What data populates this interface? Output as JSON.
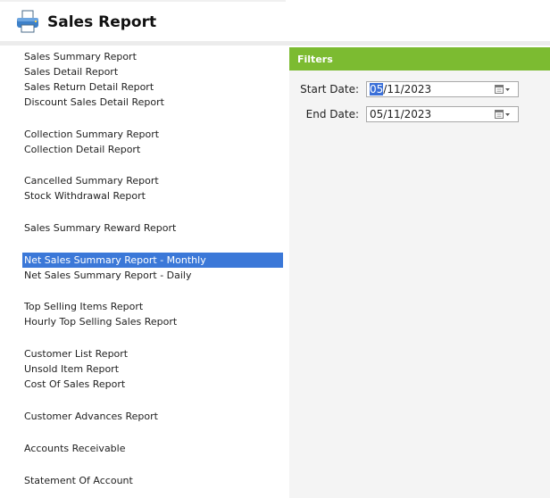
{
  "header": {
    "title": "Sales Report",
    "icon": "printer-icon"
  },
  "report_list": {
    "items": [
      {
        "label": "Sales Summary Report",
        "selected": false
      },
      {
        "label": "Sales Detail Report",
        "selected": false
      },
      {
        "label": "Sales Return Detail Report",
        "selected": false
      },
      {
        "label": "Discount Sales Detail Report",
        "selected": false
      },
      {
        "label": "Collection Summary Report",
        "selected": false
      },
      {
        "label": "Collection Detail Report",
        "selected": false
      },
      {
        "label": "Cancelled Summary Report",
        "selected": false
      },
      {
        "label": "Stock Withdrawal Report",
        "selected": false
      },
      {
        "label": "Sales Summary Reward Report",
        "selected": false
      },
      {
        "label": "Net Sales Summary Report - Monthly",
        "selected": true
      },
      {
        "label": "Net Sales Summary Report - Daily",
        "selected": false
      },
      {
        "label": "Top Selling Items Report",
        "selected": false
      },
      {
        "label": "Hourly Top Selling Sales Report",
        "selected": false
      },
      {
        "label": "Customer List Report",
        "selected": false
      },
      {
        "label": "Unsold Item Report",
        "selected": false
      },
      {
        "label": "Cost Of Sales Report",
        "selected": false
      },
      {
        "label": "Customer Advances Report",
        "selected": false
      },
      {
        "label": "Accounts Receivable",
        "selected": false
      },
      {
        "label": "Statement Of Account",
        "selected": false
      }
    ]
  },
  "filters": {
    "title": "Filters",
    "start_date": {
      "label": "Start Date:",
      "value_selected_part": "05",
      "value_rest": "/11/2023"
    },
    "end_date": {
      "label": "End Date:",
      "value": "05/11/2023"
    }
  },
  "colors": {
    "accent_green": "#7cbb31",
    "selection_blue": "#3b78d8"
  }
}
